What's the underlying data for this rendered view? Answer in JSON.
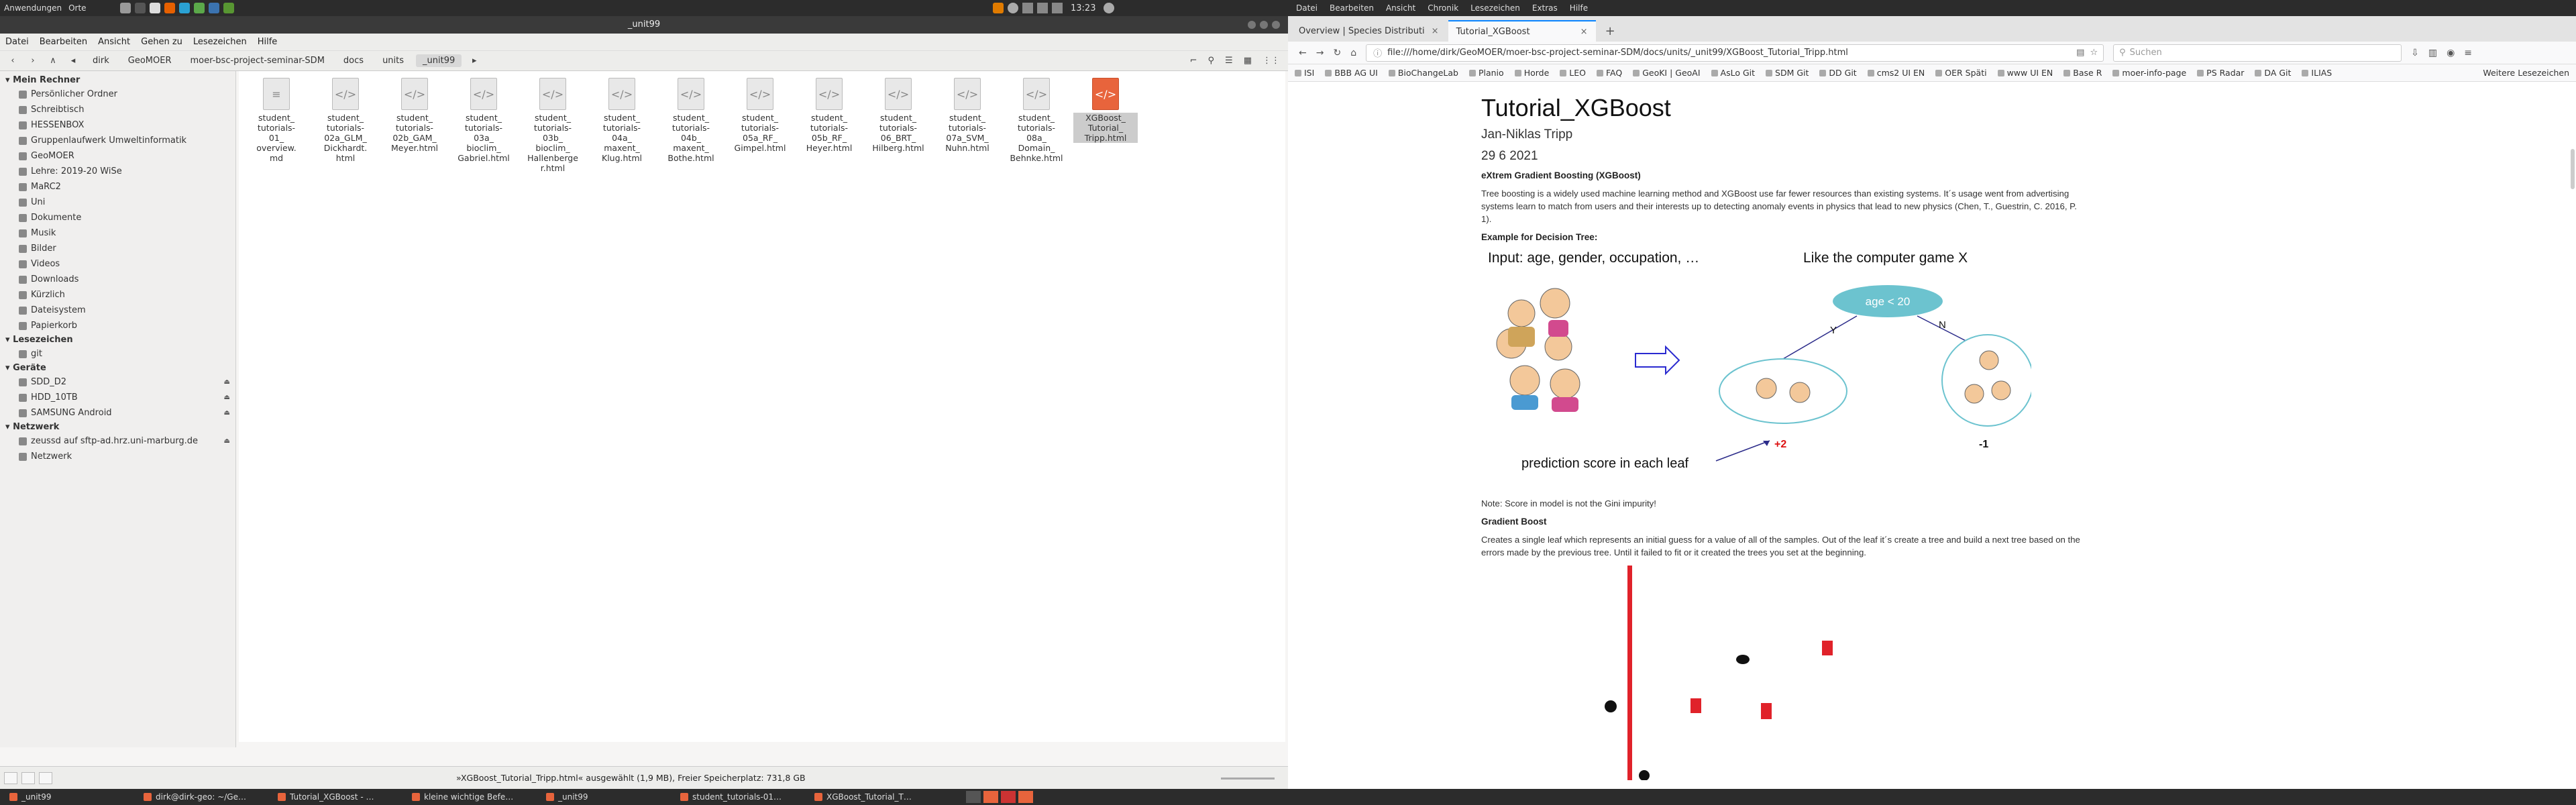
{
  "top_panel": {
    "applications": "Anwendungen",
    "places": "Orte",
    "clock": "13:23"
  },
  "firefox_menu": [
    "Datei",
    "Bearbeiten",
    "Ansicht",
    "Chronik",
    "Lesezeichen",
    "Extras",
    "Hilfe"
  ],
  "file_manager": {
    "title": "_unit99",
    "menu": [
      "Datei",
      "Bearbeiten",
      "Ansicht",
      "Gehen zu",
      "Lesezeichen",
      "Hilfe"
    ],
    "breadcrumbs": [
      "dirk",
      "GeoMOER",
      "moer-bsc-project-seminar-SDM",
      "docs",
      "units",
      "_unit99"
    ],
    "sidebar": {
      "my_computer": {
        "title": "Mein Rechner",
        "items": [
          "Persönlicher Ordner",
          "Schreibtisch",
          "HESSENBOX",
          "Gruppenlaufwerk Umweltinformatik",
          "GeoMOER",
          "Lehre: 2019-20 WiSe",
          "MaRC2",
          "Uni",
          "Dokumente",
          "Musik",
          "Bilder",
          "Videos",
          "Downloads",
          "Kürzlich",
          "Dateisystem",
          "Papierkorb"
        ]
      },
      "bookmarks": {
        "title": "Lesezeichen",
        "items": [
          "git"
        ]
      },
      "devices": {
        "title": "Geräte",
        "items": [
          "SDD_D2",
          "HDD_10TB",
          "SAMSUNG Android"
        ]
      },
      "network": {
        "title": "Netzwerk",
        "items": [
          "zeussd auf sftp-ad.hrz.uni-marburg.de",
          "Netzwerk"
        ]
      }
    },
    "files": [
      "student_\ntutorials-\n01_\noverview.\nmd",
      "student_\ntutorials-\n02a_GLM_\nDickhardt.\nhtml",
      "student_\ntutorials-\n02b_GAM_\nMeyer.html",
      "student_\ntutorials-\n03a_\nbioclim_\nGabriel.html",
      "student_\ntutorials-\n03b_\nbioclim_\nHallenberge\nr.html",
      "student_\ntutorials-\n04a_\nmaxent_\nKlug.html",
      "student_\ntutorials-\n04b_\nmaxent_\nBothe.html",
      "student_\ntutorials-\n05a_RF_\nGimpel.html",
      "student_\ntutorials-\n05b_RF_\nHeyer.html",
      "student_\ntutorials-\n06_BRT_\nHilberg.html",
      "student_\ntutorials-\n07a_SVM_\nNuhn.html",
      "student_\ntutorials-\n08a_\nDomain_\nBehnke.html",
      "XGBoost_\nTutorial_\nTripp.html"
    ],
    "status": "»XGBoost_Tutorial_Tripp.html« ausgewählt (1,9 MB), Freier Speicherplatz: 731,8 GB"
  },
  "browser": {
    "tabs": [
      "Overview | Species Distributi",
      "Tutorial_XGBoost"
    ],
    "url": "file:///home/dirk/GeoMOER/moer-bsc-project-seminar-SDM/docs/units/_unit99/XGBoost_Tutorial_Tripp.html",
    "search_placeholder": "Suchen",
    "bookmarks": [
      "ISI",
      "BBB AG UI",
      "BioChangeLab",
      "Planio",
      "Horde",
      "LEO",
      "FAQ",
      "GeoKI | GeoAI",
      "AsLo Git",
      "SDM Git",
      "DD Git",
      "cms2 UI EN",
      "OER Späti",
      "www UI EN",
      "Base R",
      "moer-info-page",
      "PS Radar",
      "DA Git",
      "ILIAS"
    ],
    "bookmarks_more": "Weitere Lesezeichen",
    "doc": {
      "title": "Tutorial_XGBoost",
      "author": "Jan-Niklas Tripp",
      "date": "29 6 2021",
      "h_xgb": "eXtrem Gradient Boosting (XGBoost)",
      "p_xgb": "Tree boosting is a widely used machine learning method and XGBoost use far fewer resources than existing systems. It´s usage went from advertising systems learn to match from users and their interests up to detecting anomaly events in physics that lead to new physics (Chen, T., Guestrin, C. 2016, P. 1).",
      "h_example": "Example for Decision Tree:",
      "fig_input": "Input: age, gender, occupation, …",
      "fig_game": "Like the computer game X",
      "fig_node": "age < 20",
      "fig_y": "Y",
      "fig_n": "N",
      "fig_plus": "+2",
      "fig_minus": "-1",
      "fig_pred": "prediction score in each leaf",
      "note": "Note: Score in model is not the Gini impurity!",
      "h_gb": "Gradient Boost",
      "p_gb": "Creates a single leaf which represents an initial guess for a value of all of the samples. Out of the leaf it´s create a tree and build a next tree based on the errors made by the previous tree. Until it failed to fit or it created the trees you set at the beginning."
    }
  },
  "taskbar": [
    "_unit99",
    "dirk@dirk-geo: ~/Ge…",
    "Tutorial_XGBoost - …",
    "kleine wichtige Befe…",
    "_unit99",
    "student_tutorials-01…",
    "XGBoost_Tutorial_T…"
  ]
}
